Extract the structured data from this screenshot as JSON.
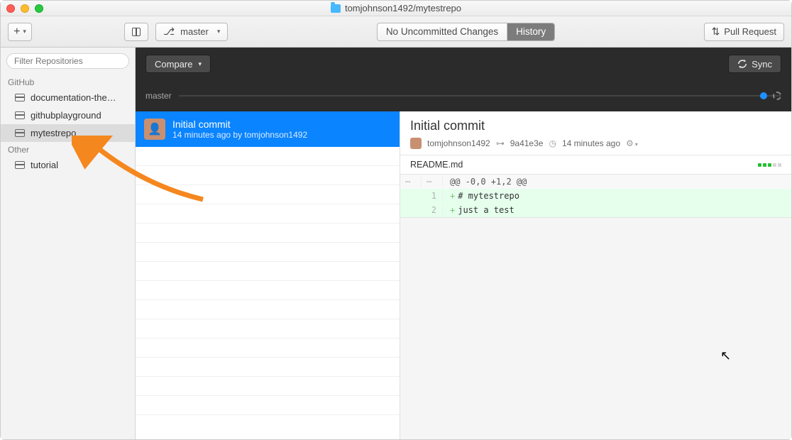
{
  "window": {
    "title": "tomjohnson1492/mytestrepo"
  },
  "toolbar": {
    "branch": "master",
    "seg_left": "No Uncommitted Changes",
    "seg_right": "History",
    "pull_request": "Pull Request"
  },
  "sidebar": {
    "filter_placeholder": "Filter Repositories",
    "section1": "GitHub",
    "section2": "Other",
    "repos_github": [
      {
        "label": "documentation-the…"
      },
      {
        "label": "githubplayground"
      },
      {
        "label": "mytestrepo"
      }
    ],
    "repos_other": [
      {
        "label": "tutorial"
      }
    ]
  },
  "historybar": {
    "compare": "Compare",
    "sync": "Sync",
    "branch_label": "master"
  },
  "commit": {
    "title": "Initial commit",
    "subtitle": "14 minutes ago by tomjohnson1492"
  },
  "detail": {
    "title": "Initial commit",
    "author": "tomjohnson1492",
    "hash": "9a41e3e",
    "time": "14 minutes ago",
    "file": "README.md",
    "hunk": "@@ -0,0 +1,2 @@",
    "lines": [
      {
        "num": "1",
        "text": "# mytestrepo"
      },
      {
        "num": "2",
        "text": "just a test"
      }
    ]
  }
}
